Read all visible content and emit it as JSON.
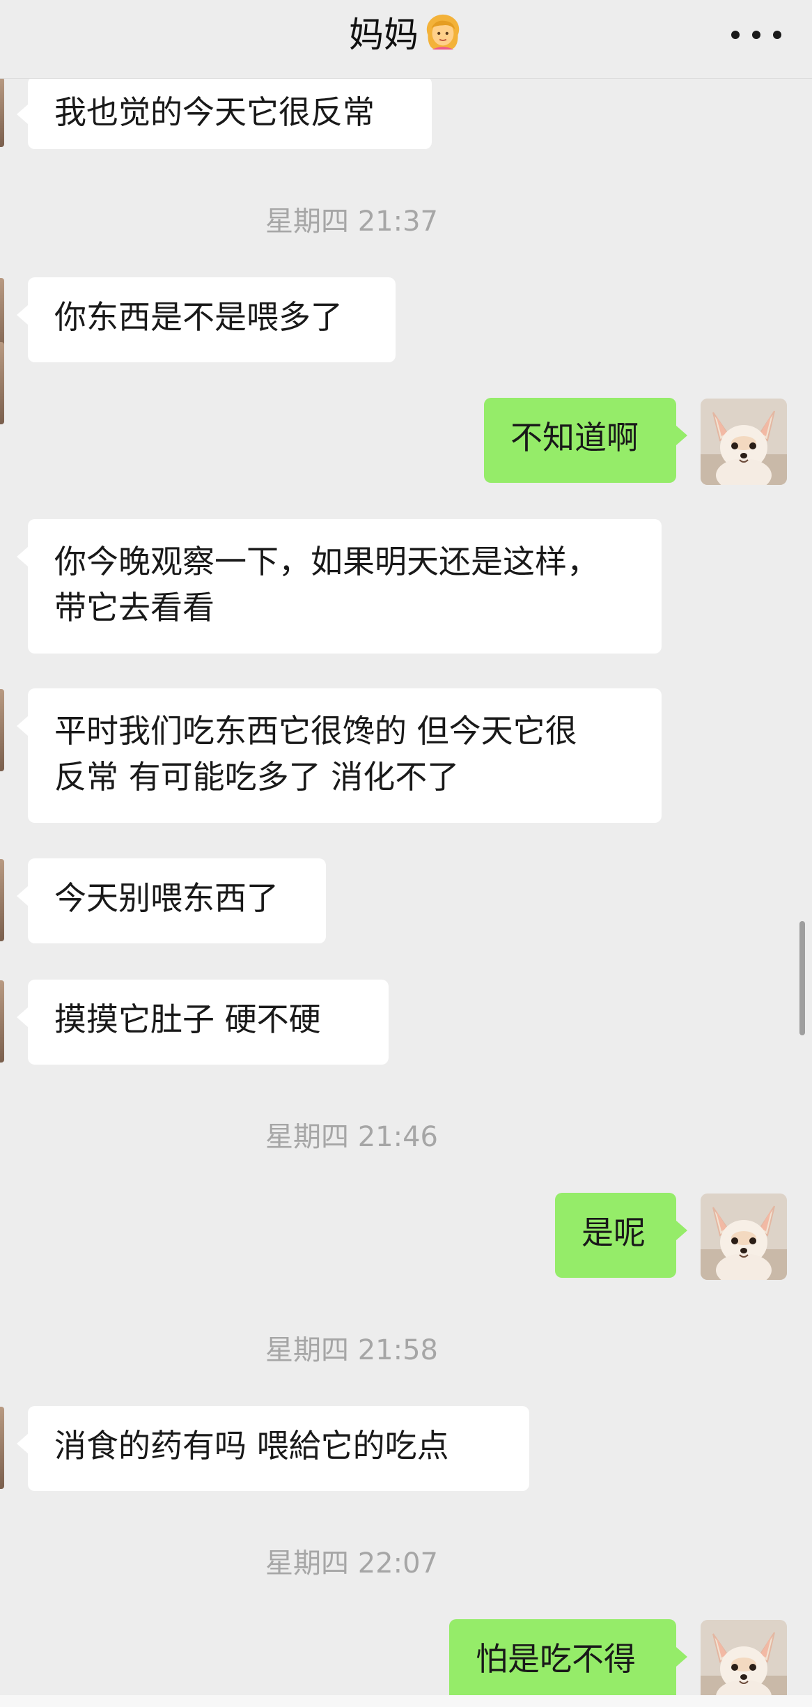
{
  "header": {
    "title": "妈妈",
    "title_emoji": "woman-emoji-icon",
    "more_icon": "more-dots-icon"
  },
  "messages": [
    {
      "side": "left",
      "text": "我也觉的今天它很反常"
    },
    {
      "timestamp": "星期四 21:37"
    },
    {
      "side": "left",
      "text": "你东西是不是喂多了"
    },
    {
      "side": "right",
      "text": "不知道啊"
    },
    {
      "side": "left",
      "lines": [
        "你今晚观察一下，如果明天还是这样，",
        "带它去看看"
      ]
    },
    {
      "side": "left",
      "lines": [
        "平时我们吃东西它很馋的  但今天它很",
        "反常  有可能吃多了 消化不了"
      ]
    },
    {
      "side": "left",
      "text": "今天别喂东西了"
    },
    {
      "side": "left",
      "text": "摸摸它肚子   硬不硬"
    },
    {
      "timestamp": "星期四 21:46"
    },
    {
      "side": "right",
      "text": "是呢"
    },
    {
      "timestamp": "星期四 21:58"
    },
    {
      "side": "left",
      "text": "消食的药有吗   喂給它的吃点"
    },
    {
      "timestamp": "星期四 22:07"
    },
    {
      "side": "right",
      "text": "怕是吃不得"
    }
  ],
  "colors": {
    "background": "#ededed",
    "bubble_left": "#ffffff",
    "bubble_right": "#95ec69",
    "timestamp": "#a6a6a6"
  },
  "avatar_icon": "puppy-avatar-icon"
}
